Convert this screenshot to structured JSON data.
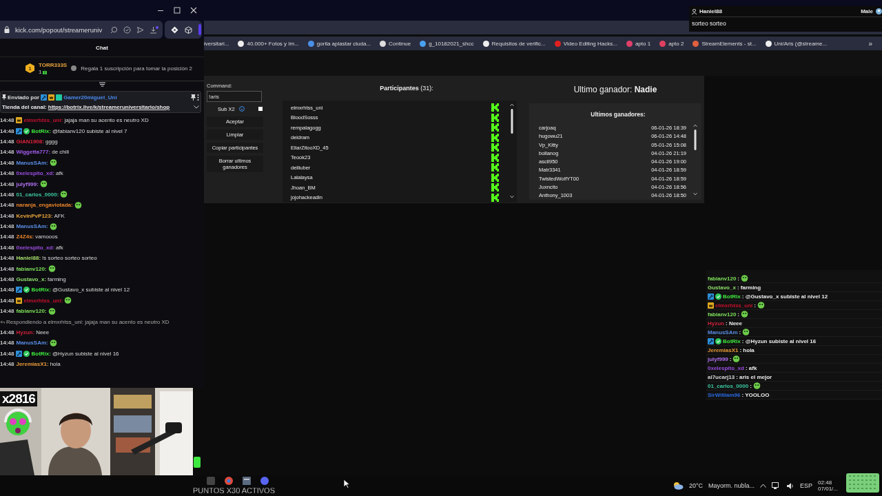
{
  "chat_window": {
    "url": "kick.com/popout/streameruniv",
    "title": "Chat",
    "leaderboard": {
      "rank": "1",
      "user": "TORR333S",
      "count": "1",
      "gift": "Regala 1 suscripción para tomar la posición 2"
    },
    "pinned": {
      "sent_by": "Enviado por",
      "user": "Gamer20miguel_Uni",
      "label": "Tienda del canal:",
      "link": "https://botrix.live/k/streameruniversitario/shop"
    },
    "messages": [
      {
        "kind": "msg",
        "time": "14:48",
        "crown": true,
        "user": "elmxrhtss_uni:",
        "color": "#c8102e",
        "text": "jajaja man su acento es neutro XD"
      },
      {
        "kind": "msg",
        "time": "14:48",
        "mod": true,
        "verified": true,
        "user": "BotRix:",
        "color": "#3ee83e",
        "text": "@fabianv120 subiste al nivel 7"
      },
      {
        "kind": "msg",
        "time": "14:48",
        "user": "GIAN1908:",
        "color": "#e0203a",
        "text": "gggg"
      },
      {
        "kind": "msg",
        "time": "14:48",
        "user": "Wiggetta777:",
        "color": "#a45cf0",
        "text": "de chill"
      },
      {
        "kind": "msg",
        "time": "14:48",
        "user": "ManusSAm:",
        "color": "#5a8ee8",
        "emote": true
      },
      {
        "kind": "msg",
        "time": "14:48",
        "user": "0xelespito_xd:",
        "color": "#9b4de0",
        "text": "afk"
      },
      {
        "kind": "msg",
        "time": "14:48",
        "user": "julyf999:",
        "color": "#b070f0",
        "emote": true
      },
      {
        "kind": "msg",
        "time": "14:48",
        "user": "01_carlos_0000:",
        "color": "#3cc8a0",
        "emote": true
      },
      {
        "kind": "msg",
        "time": "14:48",
        "user": "naranja_engaviotada:",
        "color": "#e8832a",
        "emote": true
      },
      {
        "kind": "msg",
        "time": "14:48",
        "user": "KevinPvP123:",
        "color": "#e8a33a",
        "text": "AFK"
      },
      {
        "kind": "msg",
        "time": "14:48",
        "user": "ManusSAm:",
        "color": "#5a8ee8",
        "emote": true
      },
      {
        "kind": "msg",
        "time": "14:48",
        "user": "Z4Z4s:",
        "color": "#e8832a",
        "text": "vamooos"
      },
      {
        "kind": "msg",
        "time": "14:48",
        "user": "0xelespito_xd:",
        "color": "#9b4de0",
        "text": "afk"
      },
      {
        "kind": "msg",
        "time": "14:48",
        "user": "Haniel88:",
        "color": "#a8e06a",
        "text": "!s sorteo sorteo sorteo"
      },
      {
        "kind": "msg",
        "time": "14:48",
        "user": "fabianv120:",
        "color": "#7de05a",
        "emote": true
      },
      {
        "kind": "msg",
        "time": "14:48",
        "user": "Gustavo_x:",
        "color": "#8ee06a",
        "text": "farming"
      },
      {
        "kind": "msg",
        "time": "14:48",
        "mod": true,
        "verified": true,
        "user": "BotRix:",
        "color": "#3ee83e",
        "text": "@Gustavo_x subiste al nivel 12"
      },
      {
        "kind": "msg",
        "time": "14:48",
        "crown": true,
        "user": "elmxrhtss_uni:",
        "color": "#c8102e",
        "emote": true
      },
      {
        "kind": "msg",
        "time": "14:48",
        "user": "fabianv120:",
        "color": "#7de05a",
        "emote": true
      },
      {
        "kind": "reply",
        "text": "Respondiendo a elmxrhtss_uni: jajaja man su acento es neutro XD"
      },
      {
        "kind": "msg",
        "time": "14:48",
        "user": "Hyzun:",
        "color": "#d0203a",
        "text": "Neee"
      },
      {
        "kind": "msg",
        "time": "14:48",
        "user": "ManusSAm:",
        "color": "#5a8ee8",
        "emote": true
      },
      {
        "kind": "msg",
        "time": "14:48",
        "mod": true,
        "verified": true,
        "user": "BotRix:",
        "color": "#3ee83e",
        "text": "@Hyzun subiste al nivel 16"
      },
      {
        "kind": "msg",
        "time": "14:48",
        "user": "JeremiasX1:",
        "color": "#e89a3a",
        "text": "hola"
      }
    ]
  },
  "stream_overlay": {
    "counter": "x2816",
    "banner": "PUNTOS X30 ACTIVOS"
  },
  "bookmarks": [
    "iversitari...",
    "40.000+ Fotos y Im...",
    "gorila aplastar ciuda...",
    "Continue",
    "g_10182021_shcc",
    "Requisitos de verific...",
    "Video Editing Hacks...",
    "apto 1",
    "apto 2",
    "StreamElements - st...",
    "Uni/Aris (@streame..."
  ],
  "bookmarks_more": "»",
  "notification": {
    "user": "Haniel88",
    "tag": "Male",
    "text": "sorteo sorteo"
  },
  "giveaway": {
    "command": {
      "label": "Command:",
      "value": "!aris"
    },
    "sub_x2": {
      "label": "Sub X2",
      "checked": false
    },
    "buttons": [
      "Aceptar",
      "Limpiar",
      "Copiar participantes",
      "Borrar ultimos ganadores"
    ],
    "participants_title": "**Participantes** (31):",
    "participants": [
      "elmxrhtss_uni",
      "BloodSosss",
      "rempalagogg",
      "deidram",
      "EliarZitooXD_45",
      "Teook23",
      "deiliuber",
      "Lalalaysa",
      "Jhoan_BM",
      "jojohackeadin"
    ],
    "last_winner": "Ultimo ganador: **Nadie**",
    "winners_title": "Ultimos ganadores:",
    "winners": [
      {
        "name": "carjoaq",
        "date": "06-01-26 18:39"
      },
      {
        "name": "hugowu21",
        "date": "06-01-26 14:48"
      },
      {
        "name": "Vp_Kitty",
        "date": "05-01-26 15:08"
      },
      {
        "name": "bollanog",
        "date": "04-01-26 21:19"
      },
      {
        "name": "ascil950",
        "date": "04-01-26 19:00"
      },
      {
        "name": "Matr3341",
        "date": "04-01-26 18:59"
      },
      {
        "name": "TwistedWolfYT00",
        "date": "04-01-26 18:59"
      },
      {
        "name": "Juxncito",
        "date": "04-01-26 18:56"
      },
      {
        "name": "Anthony_1003",
        "date": "04-01-26 18:50"
      }
    ]
  },
  "overlay_chat": [
    {
      "user": "fabianv120",
      "color": "#7de05a",
      "text": ":",
      "emote": true
    },
    {
      "user": "Gustavo_x",
      "color": "#8ee06a",
      "text": ": farming"
    },
    {
      "user": "BotRix",
      "color": "#3ee83e",
      "mod": true,
      "verified": true,
      "text": ": @Gustavo_x subiste al nivel 12"
    },
    {
      "user": "elmxrhtss_uni",
      "color": "#c8102e",
      "crown": true,
      "text": ":",
      "emote": true
    },
    {
      "user": "fabianv120",
      "color": "#7de05a",
      "text": ":",
      "emote": true
    },
    {
      "user": "Hyzun",
      "color": "#d0203a",
      "text": ": Neee"
    },
    {
      "user": "ManusSAm",
      "color": "#5a8ee8",
      "text": ":",
      "emote": true
    },
    {
      "user": "BotRix",
      "color": "#3ee83e",
      "mod": true,
      "verified": true,
      "text": ": @Hyzun subiste al nivel 16"
    },
    {
      "user": "JeremiasX1",
      "color": "#e89a3a",
      "text": ": hola"
    },
    {
      "user": "julyf999",
      "color": "#b070f0",
      "text": ":",
      "emote": true
    },
    {
      "user": "0xelespito_xd",
      "color": "#9b4de0",
      "text": ": afk"
    },
    {
      "user": "al7ucarj13",
      "color": "#d8d8d8",
      "text": ": aris el mejor"
    },
    {
      "user": "01_carlos_0000",
      "color": "#3cc8a0",
      "text": ":",
      "emote": true
    },
    {
      "user": "SirWilliam96",
      "color": "#2a6ae0",
      "text": ": YOOLOO"
    }
  ],
  "taskbar": {
    "weather": "20°C",
    "forecast": "Mayorm. nubla...",
    "language": "ESP",
    "time": "02:48",
    "date": "07/01/..."
  }
}
